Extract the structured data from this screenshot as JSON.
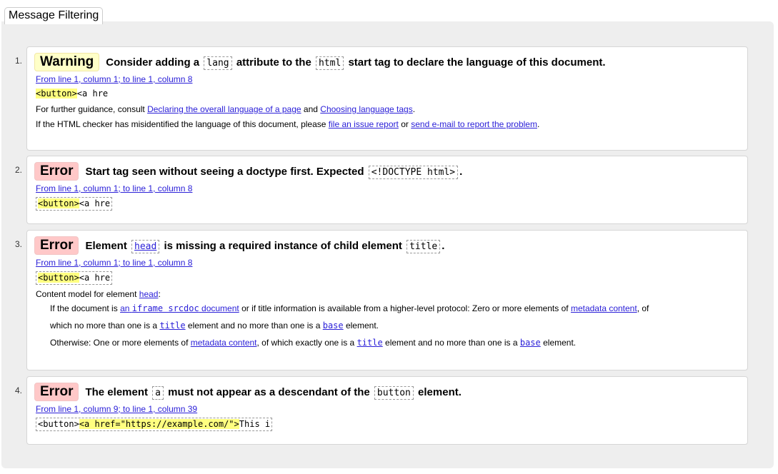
{
  "filter": {
    "label": "Message Filtering"
  },
  "messages": [
    {
      "num": "1.",
      "type": "Warning",
      "text_parts": [
        "Consider adding a",
        "lang",
        "attribute to the",
        "html",
        "start tag to declare the language of this document."
      ],
      "location": "From line 1, column 1; to line 1, column 8",
      "extract": {
        "highlight": "<button>",
        "rest": "<a hre"
      },
      "info": {
        "line1": {
          "prefix": "For further guidance, consult",
          "link1": "Declaring the overall language of a page",
          "mid": "and",
          "link2": "Choosing language tags",
          "suffix": "."
        },
        "line2": {
          "prefix": "If the HTML checker has misidentified the language of this document, please",
          "link1": "file an issue report",
          "mid": "or",
          "link2": "send e-mail to report the problem",
          "suffix": "."
        }
      }
    },
    {
      "num": "2.",
      "type": "Error",
      "text_parts": [
        "Start tag seen without seeing a doctype first. Expected",
        "<!DOCTYPE html>",
        "."
      ],
      "location": "From line 1, column 1; to line 1, column 8",
      "extract": {
        "highlight": "<button>",
        "rest": "<a hre"
      }
    },
    {
      "num": "3.",
      "type": "Error",
      "text_parts": [
        "Element",
        "head",
        "is missing a required instance of child element",
        "title",
        "."
      ],
      "location": "From line 1, column 1; to line 1, column 8",
      "extract": {
        "highlight": "<button>",
        "rest": "<a hre"
      },
      "content_model": {
        "intro": "Content model for element",
        "intro_link": "head",
        "intro_suffix": ":",
        "p1_a": "If the document is",
        "p1_link1_pre": "an",
        "p1_link1_code": "iframe srcdoc",
        "p1_link1_post": "document",
        "p1_b": "or if title information is available from a higher-level protocol: Zero or more elements of",
        "p1_link2": "metadata content",
        "p1_c": ", of",
        "p2_a": "which no more than one is a",
        "p2_link1": "title",
        "p2_b": "element and no more than one is a",
        "p2_link2": "base",
        "p2_c": "element.",
        "p3_a": "Otherwise: One or more elements of",
        "p3_link1": "metadata content",
        "p3_b": ", of which exactly one is a",
        "p3_link2": "title",
        "p3_c": "element and no more than one is a",
        "p3_link3": "base",
        "p3_d": "element."
      }
    },
    {
      "num": "4.",
      "type": "Error",
      "text_parts": [
        "The element",
        "a",
        "must not appear as a descendant of the",
        "button",
        "element."
      ],
      "location": "From line 1, column 9; to line 1, column 39",
      "extract": {
        "pre": "<button>",
        "highlight": "<a href=\"https://example.com/\">",
        "rest": "This i"
      }
    }
  ]
}
